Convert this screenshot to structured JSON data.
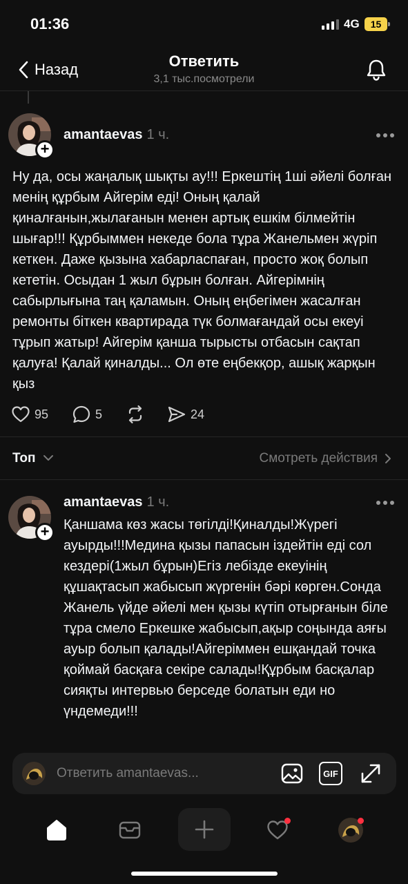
{
  "status_bar": {
    "time": "01:36",
    "network": "4G",
    "battery": "15"
  },
  "header": {
    "back_label": "Назад",
    "title": "Ответить",
    "subtitle": "3,1 тыс.посмотрели"
  },
  "post": {
    "username": "amantaevas",
    "time_ago": "1 ч.",
    "text": "Ну да, осы жаңалық шықты ау!!! Еркештің 1ші әйелі болған менің құрбым Айгерім еді! Оның қалай қиналғанын,жылағанын менен артық ешкім білмейтін шығар!!! Құрбыммен некеде бола тұра Жанельмен жүріп кеткен. Даже қызына хабарласпаған, просто жоқ болып кететін. Осыдан 1 жыл бұрын болған. Айгерімнің сабырлығына таң қаламын. Оның еңбегімен жасалған ремонты біткен квартирада түк болмағандай осы екеуі тұрып жатыр! Айгерім қанша тырысты отбасын сақтап қалуға! Қалай қиналды... Ол өте еңбекқор, ашық жарқын қыз",
    "likes": "95",
    "replies": "5",
    "shares": "24"
  },
  "sort": {
    "label": "Топ",
    "activity_label": "Смотреть действия"
  },
  "reply": {
    "username": "amantaevas",
    "time_ago": "1 ч.",
    "text": "Қаншама көз жасы төгілді!Қиналды!Жүрегі ауырды!!!Медина қызы папасын іздейтін еді сол кездері(1жыл бұрын)Егіз лебізде екеуінің құшақтасып жабысып жүргенін бәрі көрген.Сонда Жанель үйде әйелі мен қызы күтіп отырғанын біле тұра смело Еркешке жабысып,ақыр соңында аяғы ауыр болып қалады!Айгеріммен ешқандай точка қоймай басқаға секіре салады!Құрбым басқалар сияқты интервью берседе болатын еди но үндемеди!!!"
  },
  "composer": {
    "placeholder": "Ответить amantaevas...",
    "gif_label": "GIF"
  },
  "icons": {
    "back": "chevron-left-icon",
    "bell": "bell-icon",
    "more": "more-dots-icon",
    "like": "heart-icon",
    "comment": "comment-icon",
    "repost": "repost-icon",
    "share": "send-icon",
    "image": "image-icon",
    "gif": "gif-icon",
    "expand": "expand-icon",
    "home": "home-icon",
    "messages": "messages-icon",
    "create": "plus-icon",
    "activity": "heart-icon",
    "profile": "profile-avatar"
  },
  "colors": {
    "background": "#101010",
    "notification_dot": "#ff3040",
    "battery": "#f6d24a"
  }
}
